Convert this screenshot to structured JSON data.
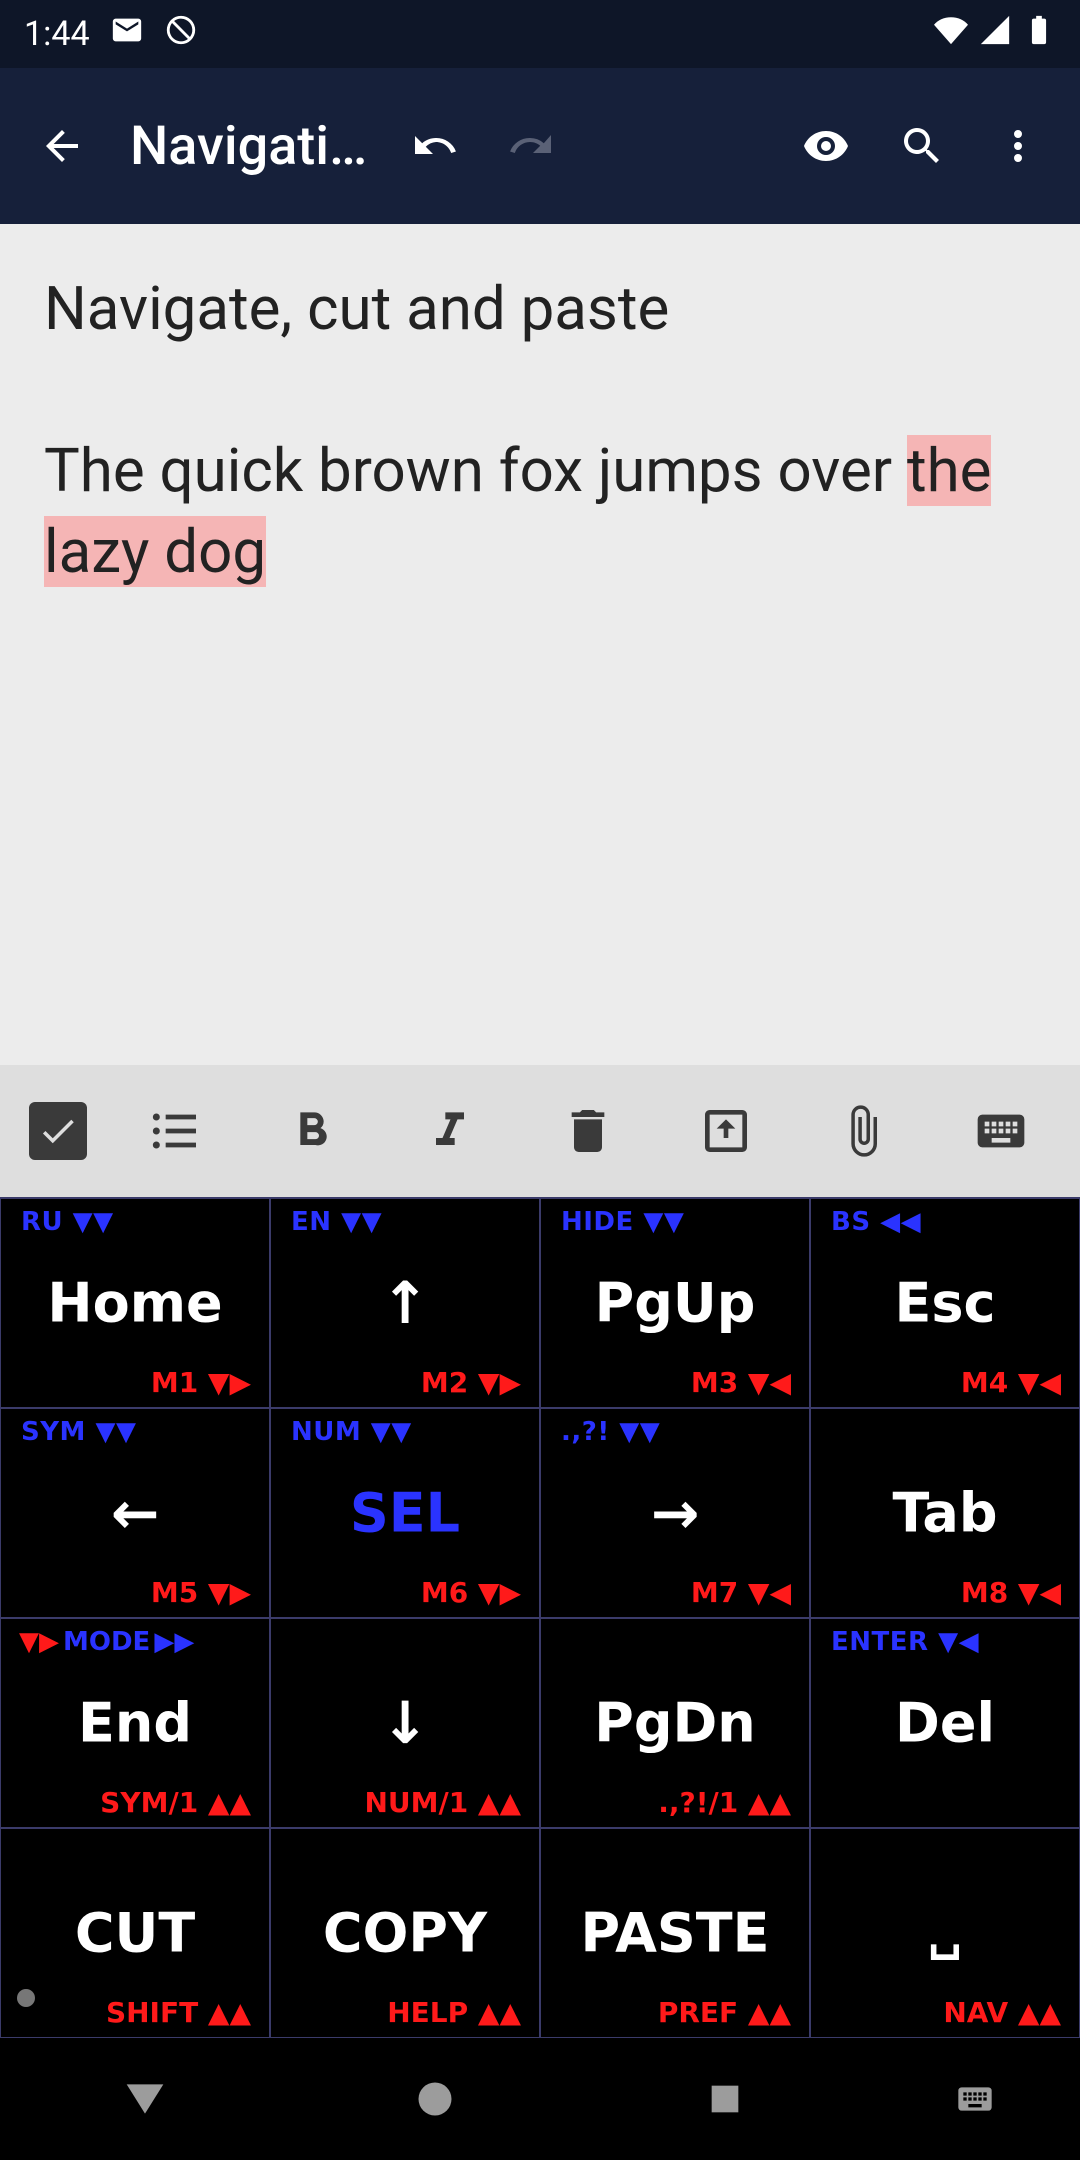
{
  "status": {
    "time": "1:44",
    "icons_left": [
      "mail-icon",
      "do-not-disturb-icon"
    ],
    "icons_right": [
      "wifi-icon",
      "cell-signal-icon",
      "battery-icon"
    ]
  },
  "appbar": {
    "title": "Navigati…"
  },
  "editor": {
    "line1": "Navigate, cut and paste",
    "line2_pre": "The quick brown fox jumps over ",
    "line2_sel": "the lazy dog"
  },
  "keyboard": {
    "rows": [
      [
        {
          "top": "RU",
          "top_icon": "▼▼",
          "main": "Home",
          "bot": "M1",
          "bot_icon": "▼▶"
        },
        {
          "top": "EN",
          "top_icon": "▼▼",
          "main": "↑",
          "bot": "M2",
          "bot_icon": "▼▶"
        },
        {
          "top": "HIDE",
          "top_icon": "▼▼",
          "main": "PgUp",
          "bot": "M3",
          "bot_icon": "▼◀"
        },
        {
          "top": "BS",
          "top_icon": "◀◀",
          "main": "Esc",
          "bot": "M4",
          "bot_icon": "▼◀"
        }
      ],
      [
        {
          "top": "SYM",
          "top_icon": "▼▼",
          "main": "←",
          "bot": "M5",
          "bot_icon": "▼▶"
        },
        {
          "top": "NUM",
          "top_icon": "▼▼",
          "main": "SEL",
          "main_blue": true,
          "bot": "M6",
          "bot_icon": "▼▶"
        },
        {
          "top": ".,?!",
          "top_icon": "▼▼",
          "main": "→",
          "bot": "M7",
          "bot_icon": "▼◀"
        },
        {
          "top": "",
          "top_icon": "",
          "main": "Tab",
          "bot": "M8",
          "bot_icon": "▼◀"
        }
      ],
      [
        {
          "top_split": [
            "▼▶",
            "MODE",
            "▶▶"
          ],
          "main": "End",
          "bot": "SYM/1",
          "bot_icon": "▲▲"
        },
        {
          "top": "",
          "main": "↓",
          "bot": "NUM/1",
          "bot_icon": "▲▲"
        },
        {
          "top": "",
          "main": "PgDn",
          "bot": ".,?!/1",
          "bot_icon": "▲▲"
        },
        {
          "top": "ENTER",
          "top_icon": "▼◀",
          "main": "Del",
          "bot": "",
          "bot_icon": ""
        }
      ],
      [
        {
          "top": "",
          "main": "CUT",
          "bot": "SHIFT",
          "bot_icon": "▲▲",
          "mic": true
        },
        {
          "top": "",
          "main": "COPY",
          "bot": "HELP",
          "bot_icon": "▲▲"
        },
        {
          "top": "",
          "main": "PASTE",
          "bot": "PREF",
          "bot_icon": "▲▲"
        },
        {
          "top": "",
          "main": "␣",
          "bot": "NAV",
          "bot_icon": "▲▲"
        }
      ]
    ]
  }
}
